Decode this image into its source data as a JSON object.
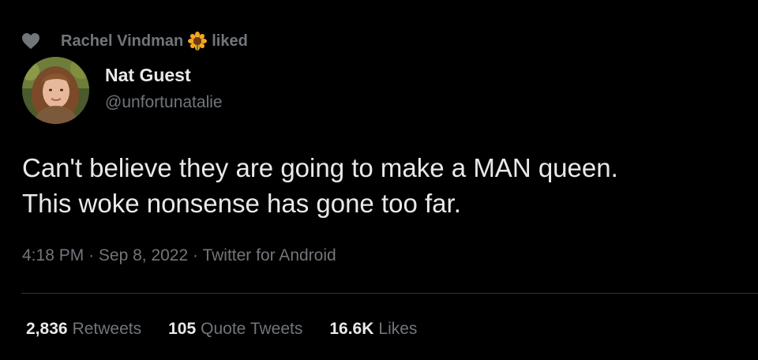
{
  "social_context": {
    "liker_name": "Rachel Vindman",
    "action": "liked",
    "emoji_icon": "sunflower-icon",
    "icon": "heart-icon"
  },
  "author": {
    "display_name": "Nat Guest",
    "handle": "@unfortunatalie",
    "avatar_icon": "avatar"
  },
  "tweet": {
    "text_lines": [
      "Can't believe they are going to make a MAN queen.",
      "This woke nonsense has gone too far."
    ]
  },
  "meta": {
    "time": "4:18 PM",
    "separator_1": "·",
    "date": "Sep 8, 2022",
    "separator_2": "·",
    "source": "Twitter for Android"
  },
  "stats": {
    "retweets": {
      "count": "2,836",
      "label": "Retweets"
    },
    "quote_tweets": {
      "count": "105",
      "label": "Quote Tweets"
    },
    "likes": {
      "count": "16.6K",
      "label": "Likes"
    }
  },
  "colors": {
    "background": "#000000",
    "primary_text": "#e7e9ea",
    "secondary_text": "#71767b",
    "divider": "#2f3336"
  }
}
